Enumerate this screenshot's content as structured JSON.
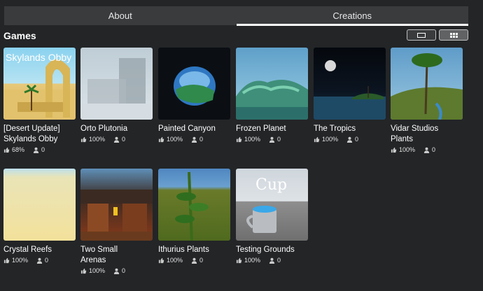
{
  "tabs": [
    {
      "label": "About",
      "active": false
    },
    {
      "label": "Creations",
      "active": true
    }
  ],
  "section_title": "Games",
  "games": [
    {
      "name_line1": "[Desert Update]",
      "name_line2": "Skylands Obby",
      "likes": "68%",
      "players": "0",
      "thumb_text": "Skylands Obby"
    },
    {
      "name_line1": "Orto Plutonia",
      "name_line2": "",
      "likes": "100%",
      "players": "0",
      "thumb_text": ""
    },
    {
      "name_line1": "Painted Canyon",
      "name_line2": "",
      "likes": "100%",
      "players": "0",
      "thumb_text": ""
    },
    {
      "name_line1": "Frozen Planet",
      "name_line2": "",
      "likes": "100%",
      "players": "0",
      "thumb_text": ""
    },
    {
      "name_line1": "The Tropics",
      "name_line2": "",
      "likes": "100%",
      "players": "0",
      "thumb_text": ""
    },
    {
      "name_line1": "Vidar Studios",
      "name_line2": "Plants",
      "likes": "100%",
      "players": "0",
      "thumb_text": ""
    },
    {
      "name_line1": "Crystal Reefs",
      "name_line2": "",
      "likes": "100%",
      "players": "0",
      "thumb_text": ""
    },
    {
      "name_line1": "Two Small",
      "name_line2": "Arenas",
      "likes": "100%",
      "players": "0",
      "thumb_text": ""
    },
    {
      "name_line1": "Ithurius Plants",
      "name_line2": "",
      "likes": "100%",
      "players": "0",
      "thumb_text": ""
    },
    {
      "name_line1": "Testing Grounds",
      "name_line2": "",
      "likes": "100%",
      "players": "0",
      "thumb_text": "Cup"
    }
  ]
}
